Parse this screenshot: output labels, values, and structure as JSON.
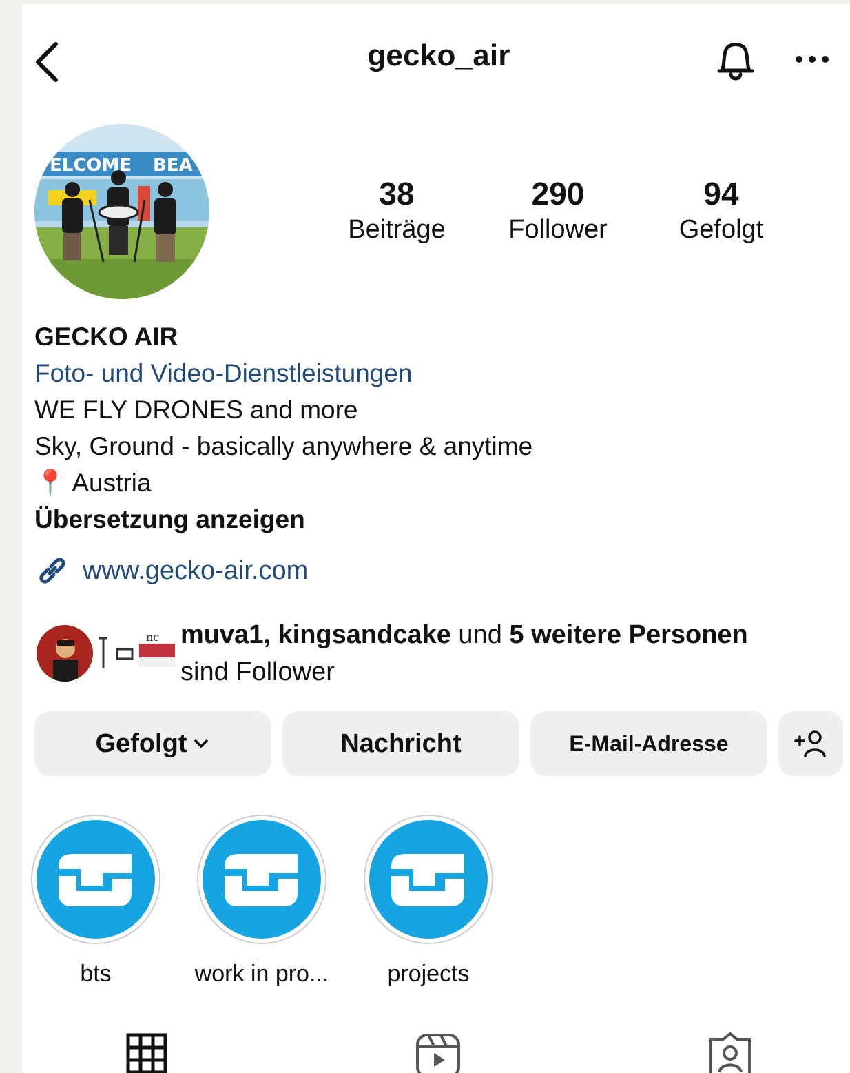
{
  "header": {
    "username": "gecko_air"
  },
  "stats": {
    "posts_count": "38",
    "posts_label": "Beiträge",
    "followers_count": "290",
    "followers_label": "Follower",
    "following_count": "94",
    "following_label": "Gefolgt"
  },
  "bio": {
    "name": "GECKO AIR",
    "category": "Foto- und Video-Dienstleistungen",
    "line1": "WE FLY DRONES and more",
    "line2": "Sky, Ground - basically anywhere & anytime",
    "location_pin": "📍",
    "location": "Austria",
    "translate": "Übersetzung anzeigen",
    "website": "www.gecko-air.com"
  },
  "mutual": {
    "names": "muva1, kingsandcake",
    "connector": "und",
    "others": "5 weitere Personen",
    "suffix": "sind Follower"
  },
  "buttons": {
    "following": "Gefolgt",
    "message": "Nachricht",
    "email": "E-Mail-Adresse",
    "add_person": "+"
  },
  "highlights": [
    {
      "label": "bts"
    },
    {
      "label": "work in pro..."
    },
    {
      "label": "projects"
    }
  ],
  "colors": {
    "link_blue": "#1f4a7a",
    "highlight_blue": "#16a4e2",
    "button_grey": "#efefef"
  },
  "icons": [
    "back-icon",
    "bell-icon",
    "more-icon",
    "link-icon",
    "chevron-down-icon",
    "add-person-icon",
    "grid-icon",
    "reels-icon",
    "tagged-icon"
  ]
}
